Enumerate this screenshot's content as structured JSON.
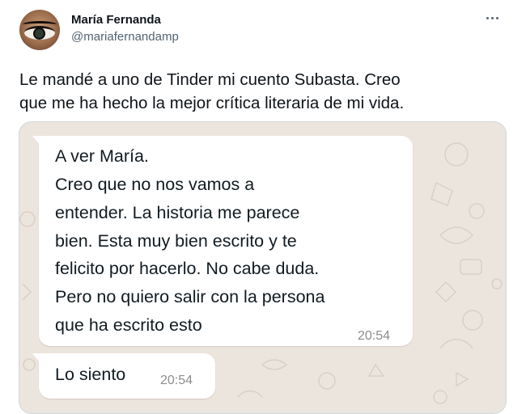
{
  "header": {
    "display_name": "María Fernanda",
    "handle": "@mariafernandamp"
  },
  "tweet": {
    "text_line1": "Le mandé a uno de Tinder mi cuento Subasta. Creo",
    "text_line2": "que me ha hecho la mejor crítica literaria de mi vida."
  },
  "chat": {
    "message1": {
      "lines": [
        "A ver María.",
        "Creo que no nos vamos a",
        "entender. La historia me parece",
        "bien. Esta muy bien escrito y te",
        "felicito por hacerlo. No cabe duda.",
        "Pero no quiero salir con la persona",
        "que ha escrito esto"
      ],
      "time": "20:54"
    },
    "message2": {
      "text": "Lo siento",
      "time": "20:54"
    }
  },
  "colors": {
    "chat_background": "#ece5dd",
    "bubble": "#ffffff",
    "secondary_text": "#536471"
  },
  "icons": {
    "more": "more-options-icon"
  }
}
